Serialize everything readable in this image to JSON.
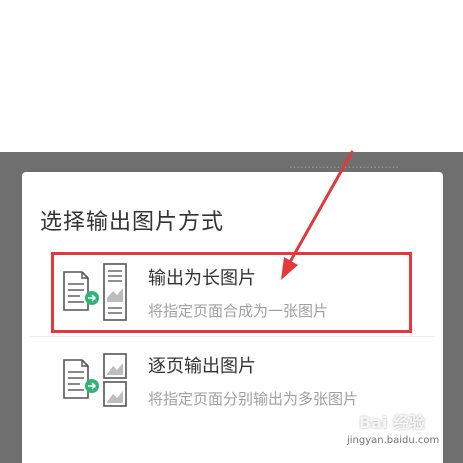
{
  "backdrop": {
    "hint_text": "…………………………"
  },
  "dialog": {
    "title": "选择输出图片方式",
    "options": [
      {
        "title": "输出为长图片",
        "description": "将指定页面合成为一张图片",
        "icon": "long-image-export-icon"
      },
      {
        "title": "逐页输出图片",
        "description": "将指定页面分别输出为多张图片",
        "icon": "page-by-page-export-icon"
      }
    ]
  },
  "annotation": {
    "highlight_color": "#e03a3a",
    "arrow_color": "#e03a3a"
  },
  "watermark": {
    "logo": "Bai 经验",
    "url": "jingyan.baidu.com"
  },
  "colors": {
    "accent_green": "#2bb673",
    "backdrop": "#6f6f6f",
    "text_primary": "#333333",
    "text_secondary": "#a0a0a0"
  }
}
